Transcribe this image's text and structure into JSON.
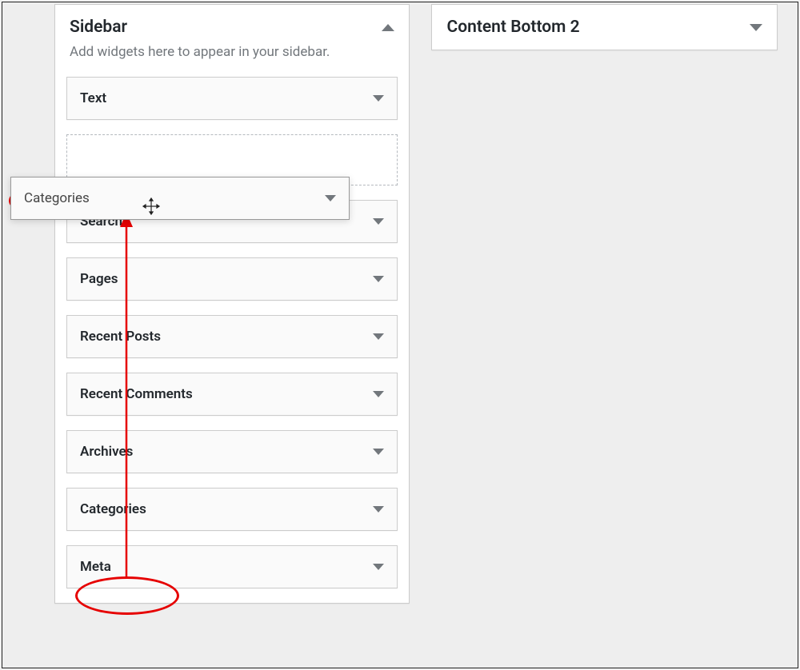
{
  "sidebar_area": {
    "title": "Sidebar",
    "description": "Add widgets here to appear in your sidebar.",
    "widgets": [
      "Text",
      "Search",
      "Pages",
      "Recent Posts",
      "Recent Comments",
      "Archives",
      "Categories",
      "Meta"
    ]
  },
  "dragging_widget": {
    "label": "Categories"
  },
  "content_bottom_area": {
    "title": "Content Bottom 2"
  }
}
